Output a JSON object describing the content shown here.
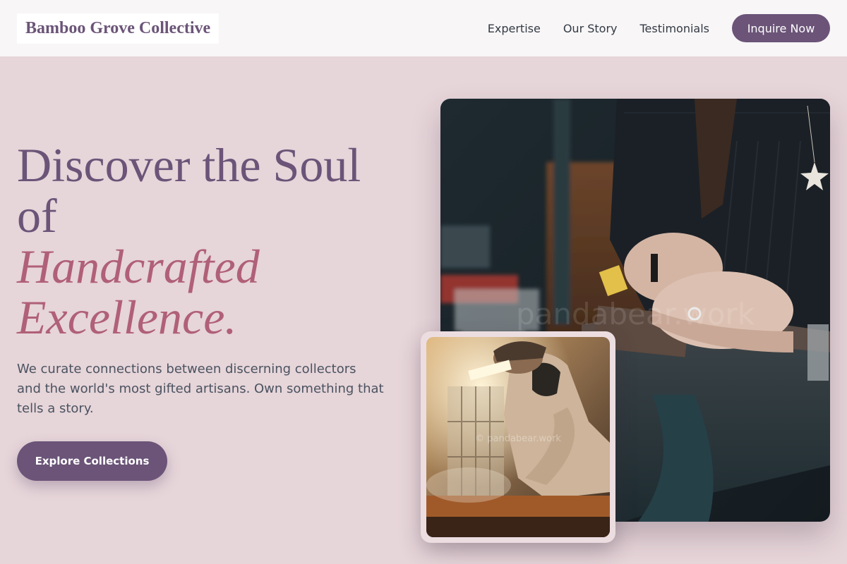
{
  "nav": {
    "logo": "Bamboo Grove Collective",
    "links": [
      "Expertise",
      "Our Story",
      "Testimonials"
    ],
    "cta": "Inquire Now"
  },
  "hero": {
    "title_line1": "Discover the Soul of",
    "title_accent": "Handcrafted Excellence.",
    "description": "We curate connections between discerning collectors and the world's most gifted artisans. Own something that tells a story.",
    "button": "Explore Collections"
  },
  "images": {
    "main_watermark": "pandabear.work",
    "inset_watermark": "© pandabear.work"
  },
  "colors": {
    "background": "#e6d5d9",
    "brand": "#6b5478",
    "accent": "#b06078"
  }
}
